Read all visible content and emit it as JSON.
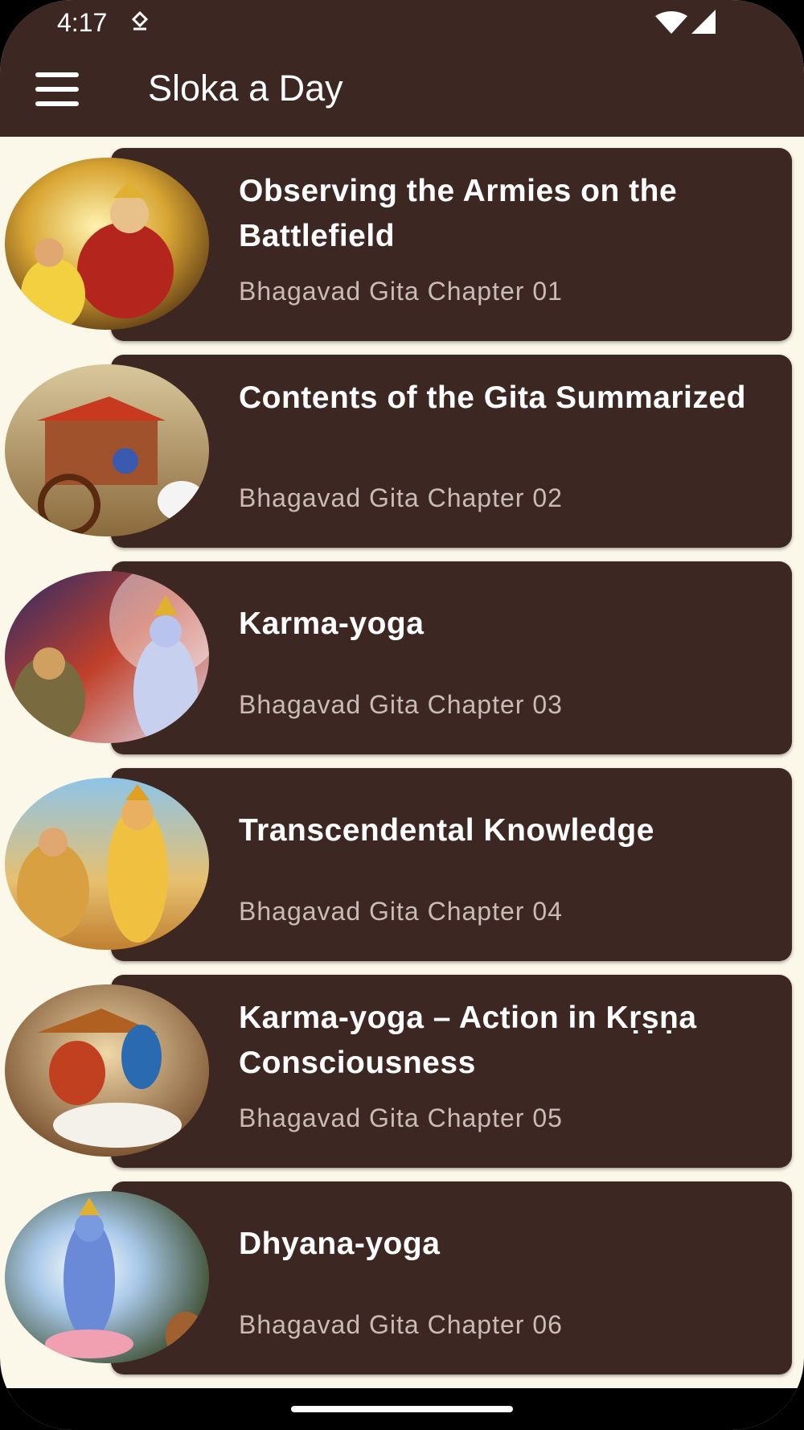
{
  "status_bar": {
    "time": "4:17",
    "icons": [
      "app-notification-icon",
      "wifi-icon",
      "signal-icon"
    ]
  },
  "app_bar": {
    "title": "Sloka a Day",
    "menu_icon": "hamburger-menu-icon"
  },
  "colors": {
    "primary": "#3d2723",
    "background": "#fbf7e9",
    "title_text": "#ffffff",
    "subtitle_text": "#c9bcb6"
  },
  "chapters": [
    {
      "title": "Observing the Armies on the Battlefield",
      "subtitle": "Bhagavad Gita Chapter 01"
    },
    {
      "title": "Contents of the Gita Summarized",
      "subtitle": "Bhagavad Gita Chapter 02"
    },
    {
      "title": "Karma-yoga",
      "subtitle": "Bhagavad Gita Chapter 03"
    },
    {
      "title": "Transcendental Knowledge",
      "subtitle": "Bhagavad Gita Chapter 04"
    },
    {
      "title": "Karma-yoga – Action in Kṛṣṇa Consciousness",
      "subtitle": "Bhagavad Gita Chapter 05"
    },
    {
      "title": "Dhyana-yoga",
      "subtitle": "Bhagavad Gita Chapter 06"
    }
  ]
}
